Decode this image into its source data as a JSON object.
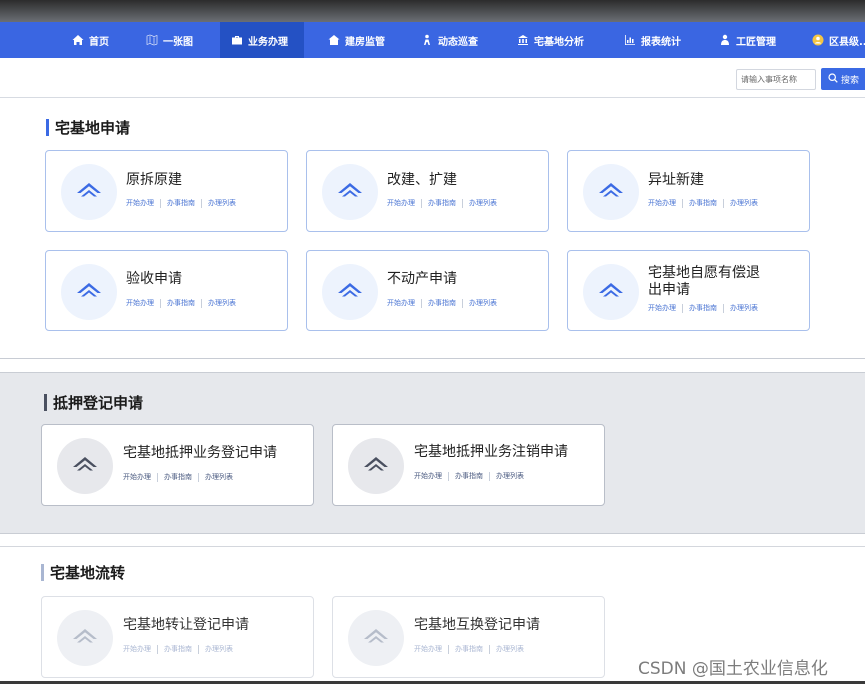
{
  "nav": {
    "items": [
      {
        "label": "首页",
        "icon": "home-icon",
        "active": false
      },
      {
        "label": "一张图",
        "icon": "map-icon",
        "active": false
      },
      {
        "label": "业务办理",
        "icon": "briefcase-icon",
        "active": true
      },
      {
        "label": "建房监管",
        "icon": "building-icon",
        "active": false
      },
      {
        "label": "动态巡查",
        "icon": "patrol-icon",
        "active": false
      },
      {
        "label": "宅基地分析",
        "icon": "bank-icon",
        "active": false
      },
      {
        "label": "报表统计",
        "icon": "chart-icon",
        "active": false
      },
      {
        "label": "工匠管理",
        "icon": "person-icon",
        "active": false
      },
      {
        "label": "区县级...",
        "icon": "user-circle-icon",
        "active": false
      }
    ]
  },
  "search": {
    "placeholder": "请输入事项名称",
    "button_label": "搜索"
  },
  "links": {
    "start": "开始办理",
    "guide": "办事指南",
    "list": "办理列表"
  },
  "sections": [
    {
      "title": "宅基地申请",
      "cards": [
        {
          "title": "原拆原建"
        },
        {
          "title": "改建、扩建"
        },
        {
          "title": "异址新建"
        },
        {
          "title": "验收申请"
        },
        {
          "title": "不动产申请"
        },
        {
          "title": "宅基地自愿有偿退出申请"
        }
      ]
    },
    {
      "title": "抵押登记申请",
      "cards": [
        {
          "title": "宅基地抵押业务登记申请"
        },
        {
          "title": "宅基地抵押业务注销申请"
        }
      ]
    },
    {
      "title": "宅基地流转",
      "cards": [
        {
          "title": "宅基地转让登记申请"
        },
        {
          "title": "宅基地互换登记申请"
        }
      ]
    }
  ],
  "watermark": "CSDN @国土农业信息化",
  "colors": {
    "nav_bg": "#3a66e2",
    "nav_active": "#2451c4",
    "accent": "#3b6ae4",
    "house_icon": "#3b6ae4",
    "house_icon_muted": "#4a5060"
  }
}
